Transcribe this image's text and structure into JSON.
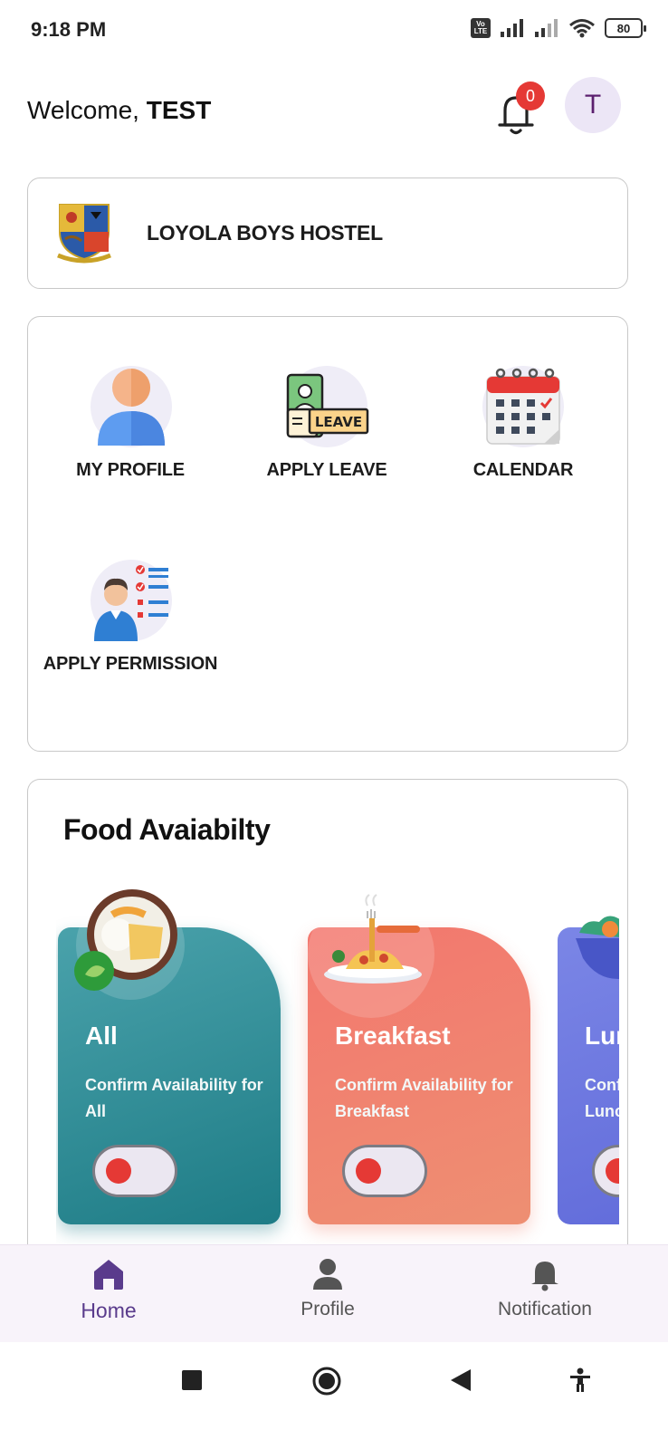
{
  "status_bar": {
    "time": "9:18 PM",
    "volte": "Vo LTE",
    "battery": "80"
  },
  "header": {
    "welcome_prefix": "Welcome, ",
    "user_name": "TEST",
    "notification_count": "0",
    "avatar_initial": "T"
  },
  "hostel": {
    "name": "LOYOLA BOYS HOSTEL"
  },
  "menu": {
    "items": [
      {
        "label": "MY PROFILE",
        "icon": "user-profile-icon"
      },
      {
        "label": "APPLY LEAVE",
        "icon": "leave-icon"
      },
      {
        "label": "CALENDAR",
        "icon": "calendar-icon"
      },
      {
        "label": "APPLY PERMISSION",
        "icon": "permission-checklist-icon"
      }
    ],
    "leave_tag": "LEAVE"
  },
  "food": {
    "title": "Food Avaiabilty",
    "tiles": [
      {
        "name": "All",
        "desc": "Confirm Availability for All",
        "enabled": false,
        "color": "#2f8f98"
      },
      {
        "name": "Breakfast",
        "desc": "Confirm Availability for Breakfast",
        "enabled": false,
        "color": "#f27c6f"
      },
      {
        "name": "Lunch",
        "desc": "Confirm Availability for Lunch",
        "enabled": false,
        "color": "#6c76df"
      }
    ]
  },
  "bottom_nav": {
    "items": [
      {
        "label": "Home",
        "active": true
      },
      {
        "label": "Profile",
        "active": false
      },
      {
        "label": "Notification",
        "active": false
      }
    ]
  },
  "colors": {
    "accent": "#5a3b8c",
    "badge": "#e53935"
  }
}
